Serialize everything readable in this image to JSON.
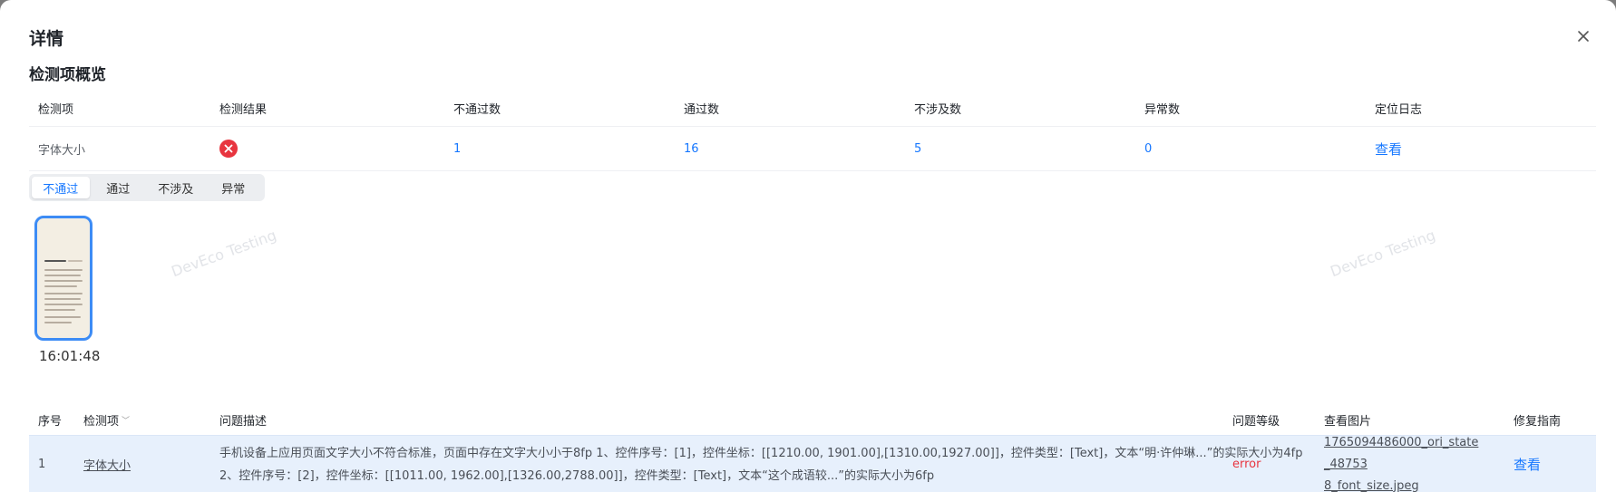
{
  "modal": {
    "title": "详情"
  },
  "overview": {
    "section_title": "检测项概览",
    "headers": [
      "检测项",
      "检测结果",
      "不通过数",
      "通过数",
      "不涉及数",
      "异常数",
      "定位日志"
    ],
    "row": {
      "item": "字体大小",
      "fail_count": "1",
      "pass_count": "16",
      "na_count": "5",
      "error_count": "0",
      "log_link": "查看"
    }
  },
  "tabs": [
    "不通过",
    "通过",
    "不涉及",
    "异常"
  ],
  "screenshot": {
    "time": "16:01:48"
  },
  "watermark": "DevEco Testing",
  "issues": {
    "headers": {
      "index": "序号",
      "item": "检测项",
      "desc": "问题描述",
      "level": "问题等级",
      "image": "查看图片",
      "guide": "修复指南"
    },
    "rows": [
      {
        "index": "1",
        "item": "字体大小",
        "desc_line1": "手机设备上应用页面文字大小不符合标准，页面中存在文字大小小于8fp 1、控件序号：[1]，控件坐标：[[1210.00, 1901.00],[1310.00,1927.00]]，控件类型：[Text]，文本“明·许仲琳...”的实际大小为4fp",
        "desc_line2": "2、控件序号：[2]，控件坐标：[[1011.00, 1962.00],[1326.00,2788.00]]，控件类型：[Text]，文本“这个成语较...”的实际大小为6fp",
        "level": "error",
        "image_line1": "1765094486000_ori_state_48753",
        "image_line2": "8_font_size.jpeg",
        "guide": "查看"
      }
    ]
  },
  "colors": {
    "accent": "#1677ff",
    "error": "#e8353f",
    "selected_row": "#e7f0fc"
  }
}
